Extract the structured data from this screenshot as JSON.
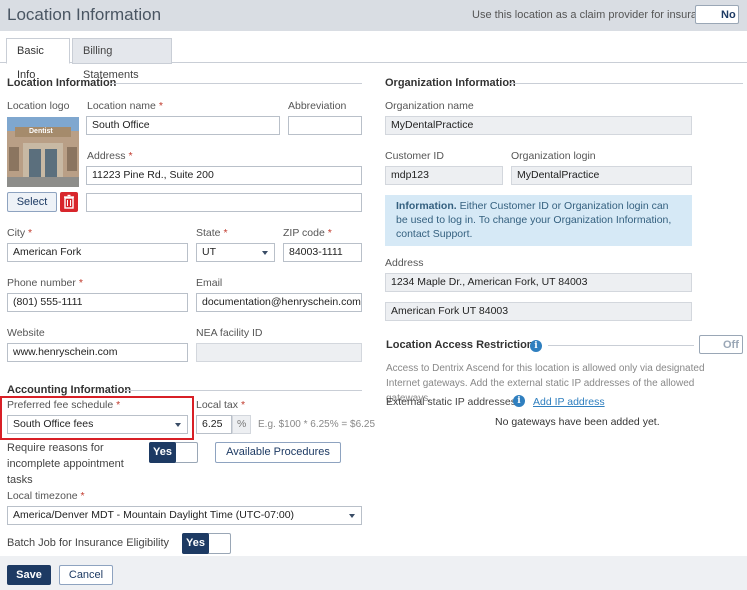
{
  "header": {
    "title": "Location Information",
    "claim_provider_label": "Use this location as a claim provider for insurance",
    "claim_provider_value": "No"
  },
  "tabs": [
    {
      "label": "Basic Info",
      "active": true
    },
    {
      "label": "Billing Statements",
      "active": false
    }
  ],
  "location": {
    "section_title": "Location Information",
    "logo_label": "Location logo",
    "logo_sign_text": "Dentist",
    "select_button": "Select",
    "name_label": "Location name",
    "name_value": "South Office",
    "abbreviation_label": "Abbreviation",
    "abbreviation_value": "",
    "address_label": "Address",
    "address1_value": "11223 Pine Rd., Suite 200",
    "address2_value": "",
    "city_label": "City",
    "city_value": "American Fork",
    "state_label": "State",
    "state_value": "UT",
    "zip_label": "ZIP code",
    "zip_value": "84003-1111",
    "phone_label": "Phone number",
    "phone_value": "(801) 555-1111",
    "email_label": "Email",
    "email_value": "documentation@henryschein.com",
    "website_label": "Website",
    "website_value": "www.henryschein.com",
    "nea_label": "NEA facility ID",
    "nea_value": "",
    "required_mark": "*"
  },
  "accounting": {
    "section_title": "Accounting Information",
    "fee_schedule_label": "Preferred fee schedule",
    "fee_schedule_value": "South Office fees",
    "local_tax_label": "Local tax",
    "local_tax_value": "6.25",
    "local_tax_unit": "%",
    "local_tax_hint": "E.g. $100 * 6.25% = $6.25",
    "require_reasons_label_1": "Require reasons for",
    "require_reasons_label_2": "incomplete appointment",
    "require_reasons_label_3": "tasks",
    "require_reasons_value": "Yes",
    "available_procedures_button": "Available Procedures",
    "timezone_label": "Local timezone",
    "timezone_value": "America/Denver MDT - Mountain Daylight Time (UTC-07:00)",
    "batch_job_label": "Batch Job for Insurance Eligibility",
    "batch_job_value": "Yes"
  },
  "organization": {
    "section_title": "Organization Information",
    "name_label": "Organization name",
    "name_value": "MyDentalPractice",
    "customer_id_label": "Customer ID",
    "customer_id_value": "mdp123",
    "login_label": "Organization login",
    "login_value": "MyDentalPractice",
    "info_bold": "Information.",
    "info_text": " Either Customer ID or Organization login can be used to log in. To change your Organization Information, contact Support.",
    "address_label": "Address",
    "address1_value": "1234 Maple Dr., American Fork, UT 84003",
    "address2_value": "American Fork UT 84003"
  },
  "access": {
    "section_title": "Location Access Restrictions",
    "toggle_value": "Off",
    "description": "Access to Dentrix Ascend for this location is allowed only via designated Internet gateways. Add the external static IP addresses of the allowed gateways.",
    "ip_label": "External static IP addresses",
    "add_ip_link": "Add IP address",
    "no_gateways": "No gateways have been added yet."
  },
  "footer": {
    "save": "Save",
    "cancel": "Cancel"
  },
  "colors": {
    "primary": "#1d3a63",
    "required": "#c0392b",
    "highlight_border": "#d81f26",
    "info_bg": "#d6e9f6"
  }
}
